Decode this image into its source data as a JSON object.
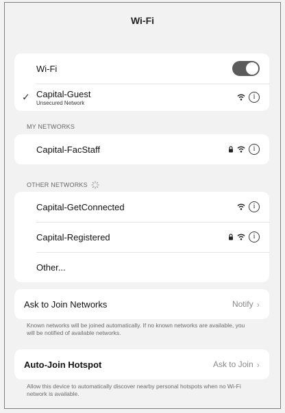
{
  "header": {
    "title": "Wi-Fi"
  },
  "wifi": {
    "toggle_label": "Wi-Fi",
    "toggle_on": true,
    "connected": {
      "name": "Capital-Guest",
      "status": "Unsecured Network"
    }
  },
  "my_networks": {
    "header": "MY NETWORKS",
    "items": [
      {
        "name": "Capital-FacStaff",
        "locked": true
      }
    ]
  },
  "other_networks": {
    "header": "OTHER NETWORKS",
    "items": [
      {
        "name": "Capital-GetConnected",
        "locked": false
      },
      {
        "name": "Capital-Registered",
        "locked": true
      }
    ],
    "other_label": "Other..."
  },
  "ask_to_join": {
    "label": "Ask to Join Networks",
    "value": "Notify",
    "footnote": "Known networks will be joined automatically. If no known networks are available, you will be notified of available networks."
  },
  "auto_join": {
    "label": "Auto-Join Hotspot",
    "value": "Ask to Join",
    "footnote": "Allow this device to automatically discover nearby personal hotspots when no Wi-Fi network is available."
  },
  "icons": {
    "check": "checkmark-icon",
    "wifi": "wifi-signal-icon",
    "lock": "lock-icon",
    "info": "info-icon",
    "spinner": "loading-spinner-icon",
    "chevron": "chevron-right-icon"
  },
  "colors": {
    "toggle_on": "#5b5b5b",
    "background": "#f2f2f2",
    "card": "#ffffff"
  }
}
